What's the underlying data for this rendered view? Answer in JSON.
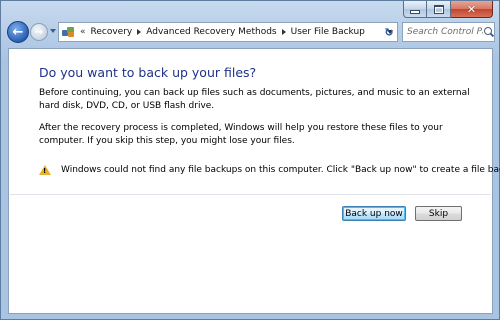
{
  "window": {
    "caption_buttons": {
      "minimize_glyph": "minimize-icon",
      "maximize_glyph": "maximize-icon",
      "close_glyph": "✕"
    }
  },
  "navigation": {
    "back_glyph": "←",
    "forward_glyph": "→",
    "breadcrumb_overflow": "«",
    "breadcrumbs": [
      "Recovery",
      "Advanced Recovery Methods",
      "User File Backup"
    ],
    "refresh_glyph": "↻",
    "search_placeholder": "Search Control Pa..."
  },
  "content": {
    "title": "Do you want to back up your files?",
    "paragraph1": "Before continuing, you can back up files such as documents, pictures, and music to an external hard disk, DVD, CD, or USB flash drive.",
    "paragraph2": "After the recovery process is completed, Windows will help you restore these files to  your computer.  If you skip this step, you might lose your files.",
    "warning_glyph": "!",
    "warning_text": "Windows could not find any file backups on this computer. Click \"Back up now\" to create a file backup."
  },
  "buttons": {
    "backup_label": "Back up now",
    "skip_label": "Skip"
  },
  "colors": {
    "title": "#1e3287",
    "frame": "#b3cbe6",
    "close_button": "#c3442a",
    "warning_icon": "#e8b12b"
  }
}
